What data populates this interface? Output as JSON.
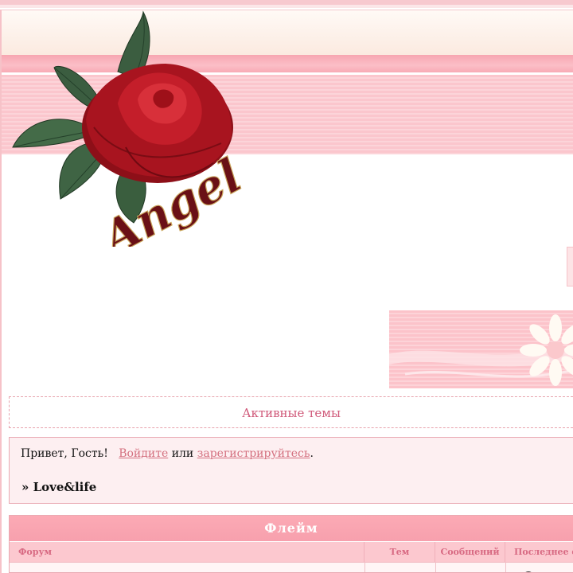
{
  "header": {
    "logo_text": "Angel"
  },
  "active_topics": {
    "label": "Активные темы"
  },
  "welcome": {
    "greeting": "Привет, Гость!",
    "login_link": "Войдите",
    "or_text": "или",
    "register_link": "зарегистрируйтесь",
    "period": "."
  },
  "breadcrumb": {
    "arrow": "»",
    "title": "Love&life"
  },
  "forum_category": {
    "title": "Флейм",
    "columns": {
      "forum": "Форум",
      "topics": "Тем",
      "posts": "Сообщений",
      "last_post": "Последнее сообщение"
    }
  },
  "colors": {
    "accent_pink": "#f7a0ad",
    "link": "#d4707f",
    "header_text": "#d86a83",
    "rose_red": "#b01822"
  }
}
